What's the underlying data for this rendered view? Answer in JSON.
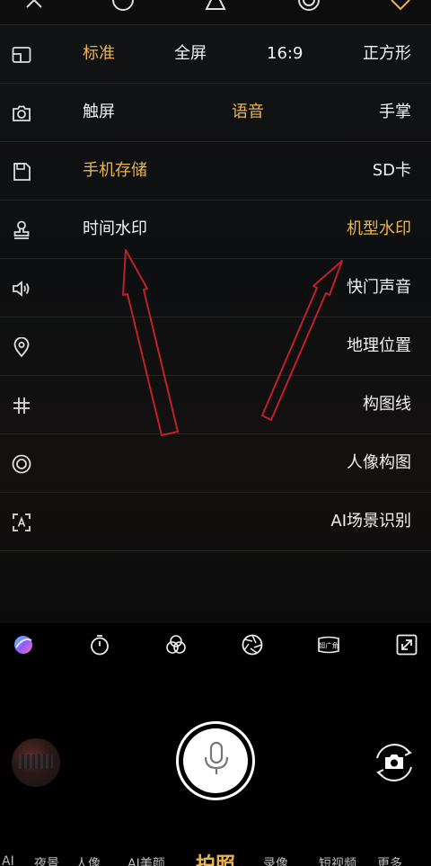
{
  "top_icons": [
    "close-icon",
    "circle-icon",
    "triangle-icon",
    "aperture-icon",
    "heart-icon"
  ],
  "settings_rows": [
    {
      "icon": "aspect-ratio-icon",
      "options": [
        {
          "label": "标准",
          "active": true
        },
        {
          "label": "全屏",
          "active": false
        },
        {
          "label": "16:9",
          "active": false
        },
        {
          "label": "正方形",
          "active": false
        }
      ]
    },
    {
      "icon": "camera-icon",
      "options": [
        {
          "label": "触屏",
          "active": false
        },
        {
          "label": "语音",
          "active": true
        },
        {
          "label": "手掌",
          "active": false
        }
      ]
    },
    {
      "icon": "save-icon",
      "options": [
        {
          "label": "手机存储",
          "active": true
        },
        {
          "label": "SD卡",
          "active": false
        }
      ]
    },
    {
      "icon": "stamp-icon",
      "options": [
        {
          "label": "时间水印",
          "active": false
        },
        {
          "label": "机型水印",
          "active": true
        }
      ]
    },
    {
      "icon": "speaker-icon",
      "label": "快门声音"
    },
    {
      "icon": "location-pin-icon",
      "label": "地理位置"
    },
    {
      "icon": "grid-icon",
      "label": "构图线"
    },
    {
      "icon": "portrait-target-icon",
      "label": "人像构图"
    },
    {
      "icon": "ai-scene-icon",
      "label": "AI场景识别"
    }
  ],
  "mode_bar_icons": [
    "color-filter-icon",
    "timer-icon",
    "filters-icon",
    "aperture-icon",
    "wide-angle-icon",
    "expand-icon"
  ],
  "wide_angle_label": "超广角",
  "shutter": {
    "icon": "microphone-icon"
  },
  "flip_camera": {
    "icon": "flip-camera-icon"
  },
  "bottom_modes": [
    {
      "label": "AI",
      "active": false
    },
    {
      "label": "夜景",
      "active": false
    },
    {
      "label": "人像",
      "active": false
    },
    {
      "label": "AI美颜",
      "active": false
    },
    {
      "label": "拍照",
      "active": true
    },
    {
      "label": "录像",
      "active": false
    },
    {
      "label": "短视频",
      "active": false
    },
    {
      "label": "更多",
      "active": false
    }
  ],
  "colors": {
    "accent": "#e9b54d",
    "text": "#f2f2f2",
    "divider": "#262626",
    "annotation_arrow": "#c0202a"
  }
}
